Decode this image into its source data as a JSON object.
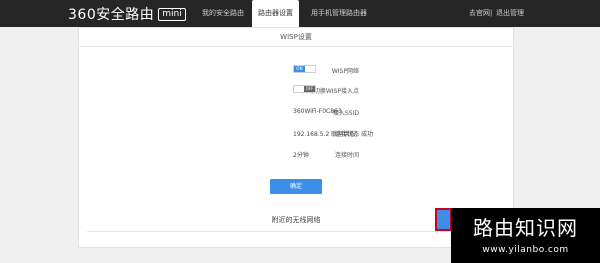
{
  "header": {
    "brand": "360安全路由",
    "brand_badge": "mini",
    "tabs": [
      {
        "label": "我的安全路由"
      },
      {
        "label": "路由器设置"
      },
      {
        "label": "用手机管理路由器"
      }
    ],
    "right_links": [
      {
        "label": "去官网"
      },
      {
        "label": "退出管理"
      }
    ],
    "separator": "|"
  },
  "panel": {
    "title": "WISP设置",
    "rows": [
      {
        "label": "WISP网络",
        "toggle_text": "ON",
        "state": "on"
      },
      {
        "label": "自动切换WISP接入点",
        "toggle_text": "OFF",
        "state": "off"
      },
      {
        "label": "接入SSID",
        "value": "360WiFi-F0C863"
      },
      {
        "label": "连接状态",
        "value": "192.168.5.2  联网状态：成功"
      },
      {
        "label": "连接时间",
        "value": "2分钟"
      }
    ],
    "confirm_label": "确定",
    "nearby_title": "附近的无线网络"
  },
  "watermark": {
    "title": "路由知识网",
    "url": "www.yilanbo.com"
  },
  "colors": {
    "topbar": "#262626",
    "accent": "#3d8ee8",
    "highlight_border": "#d0021b"
  }
}
